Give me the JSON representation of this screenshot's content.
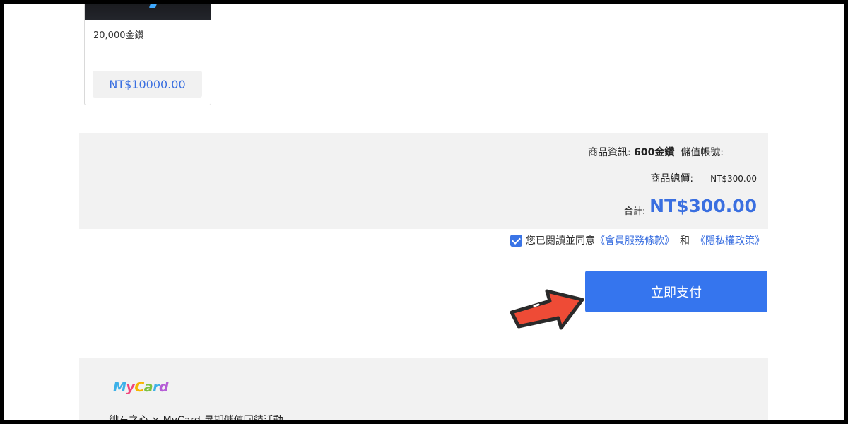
{
  "product_card": {
    "name": "20,000金鑽",
    "price_currency": "NT$",
    "price_value": "10000.00"
  },
  "summary": {
    "info_label": "商品資訊: ",
    "info_value": "600金鑽",
    "account_label": "儲值帳號:",
    "subtotal_label": "商品總價:",
    "subtotal_value": "NT$300.00",
    "total_label": "合計:",
    "total_value": "NT$300.00"
  },
  "agreement": {
    "checked": true,
    "prefix": "您已閱讀並同意",
    "terms_link": "《會員服務條款》",
    "and": "和",
    "privacy_link": "《隱私權政策》"
  },
  "pay_button": {
    "label": "立即支付"
  },
  "promo": {
    "logo_text": "MyCard",
    "title": "緋石之心 × MyCard-暑期儲值回饋活動"
  },
  "icons": {
    "arrow": "pointer-arrow-icon",
    "checkbox": "checkbox-checked-icon"
  },
  "colors": {
    "accent": "#3575ee",
    "price_blue": "#3a6fe0",
    "panel_bg": "#f2f2f2",
    "arrow_red": "#ee4b36"
  }
}
